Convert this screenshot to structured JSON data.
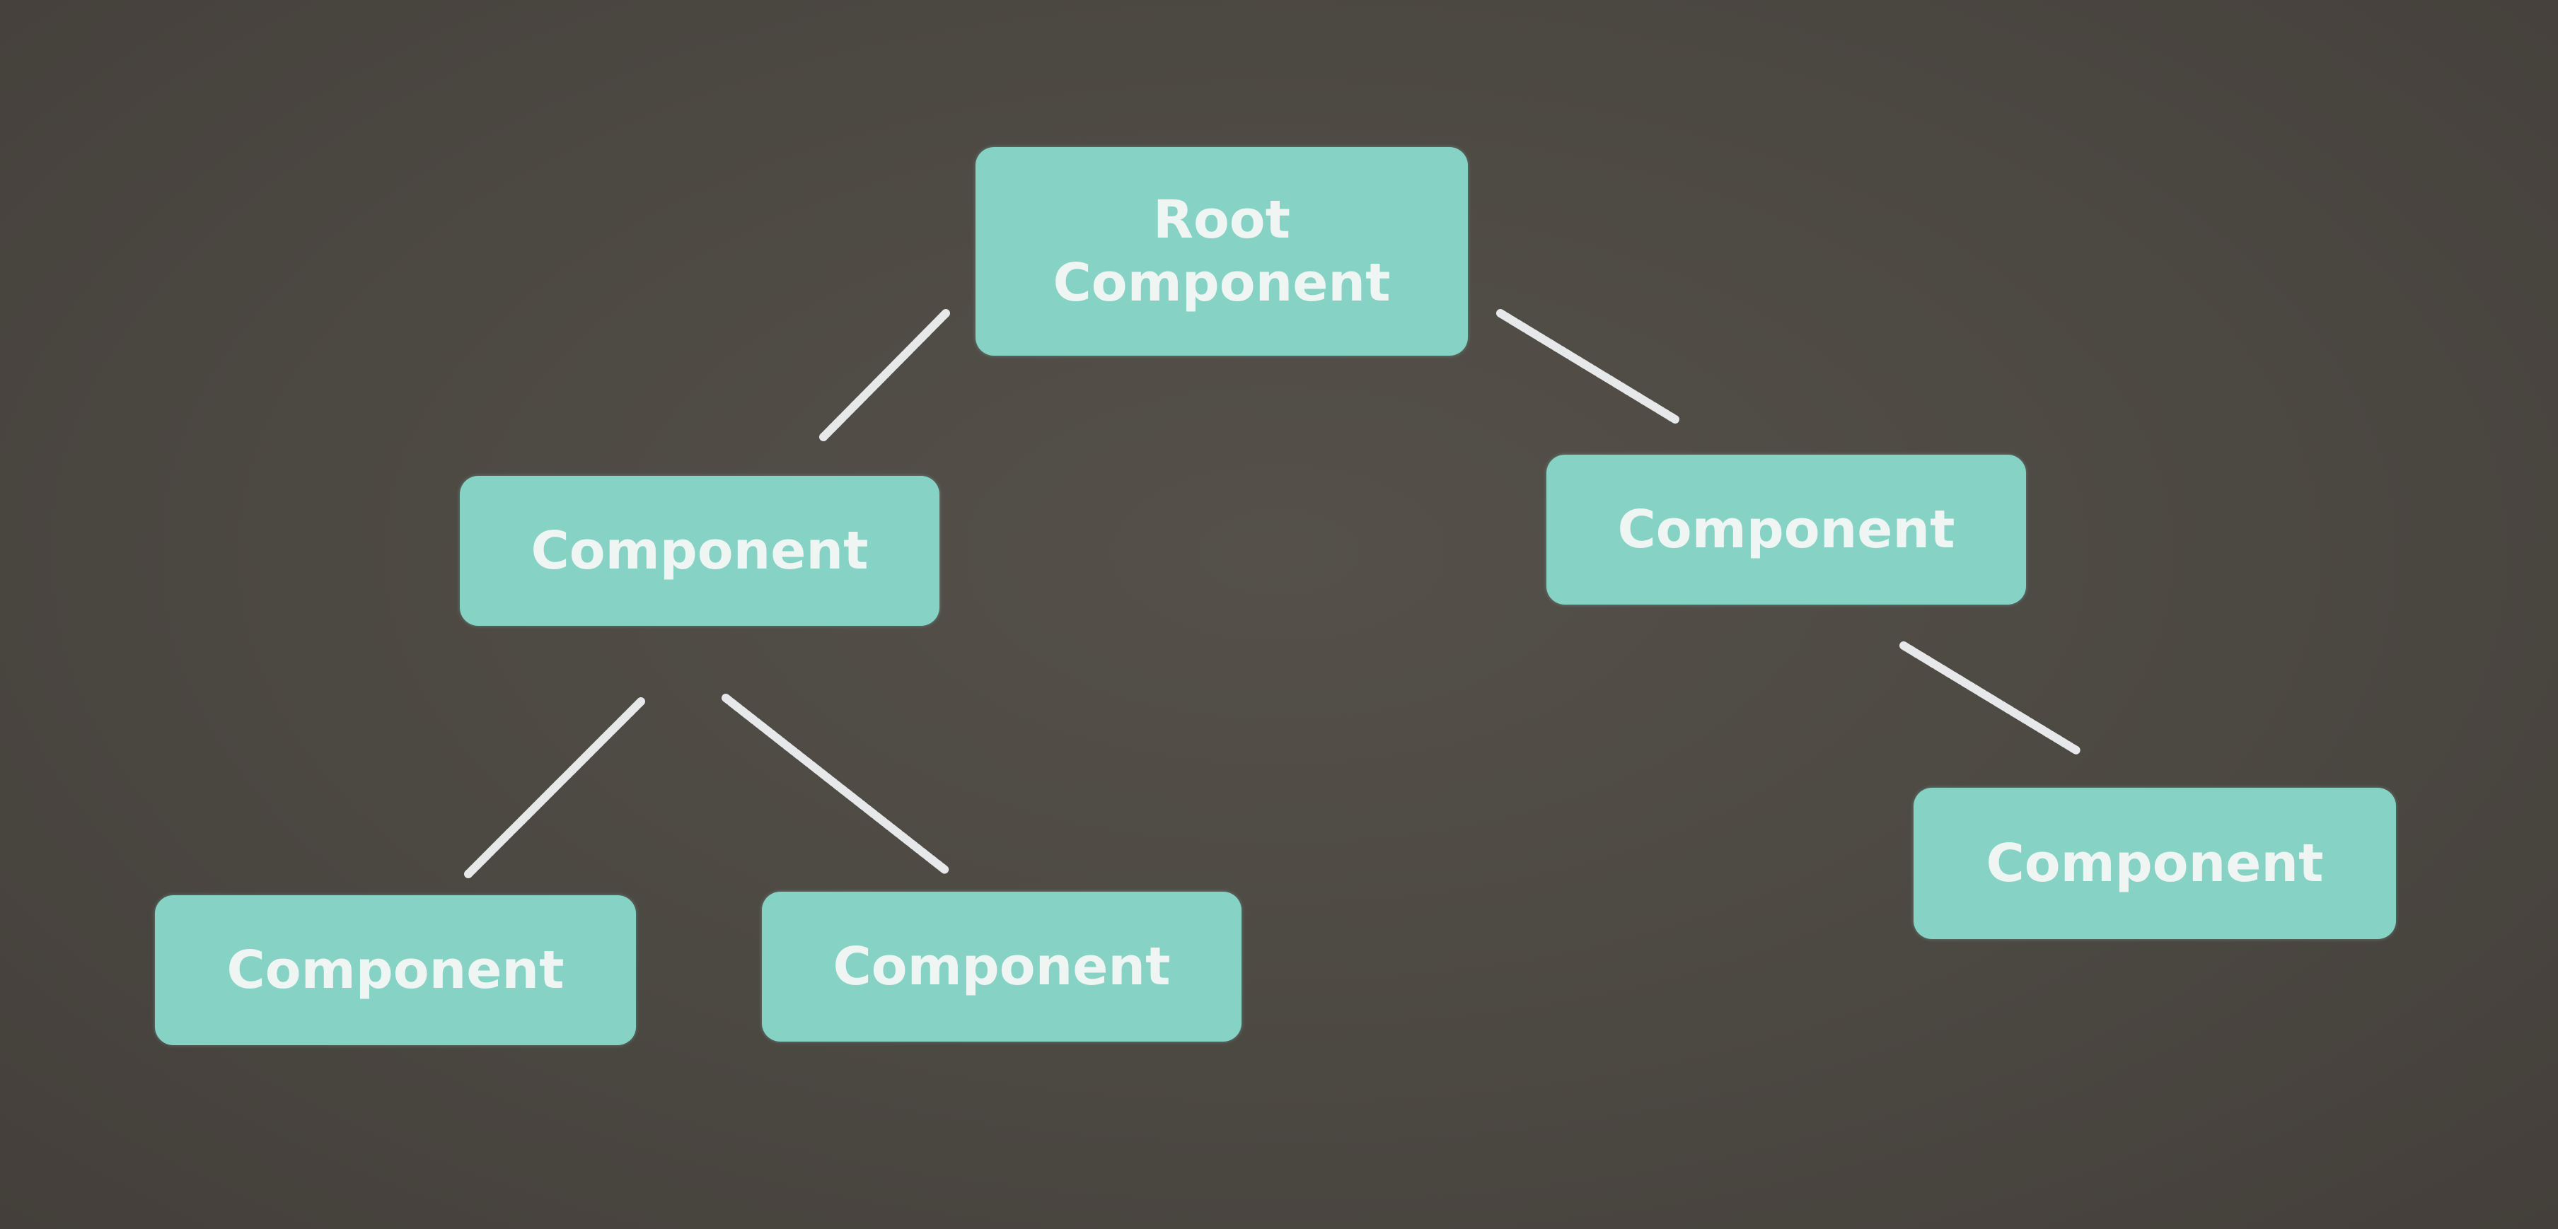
{
  "nodes": {
    "root": {
      "label": "Root Component"
    },
    "left": {
      "label": "Component"
    },
    "right": {
      "label": "Component"
    },
    "left_child_1": {
      "label": "Component"
    },
    "left_child_2": {
      "label": "Component"
    },
    "right_child": {
      "label": "Component"
    }
  },
  "edges": [
    [
      "root",
      "left"
    ],
    [
      "root",
      "right"
    ],
    [
      "left",
      "left_child_1"
    ],
    [
      "left",
      "left_child_2"
    ],
    [
      "right",
      "right_child"
    ]
  ],
  "colors": {
    "node": "#86d2c4",
    "text": "#eef5f3",
    "background": "#4e4a44",
    "edge": "#e6e8ea"
  }
}
